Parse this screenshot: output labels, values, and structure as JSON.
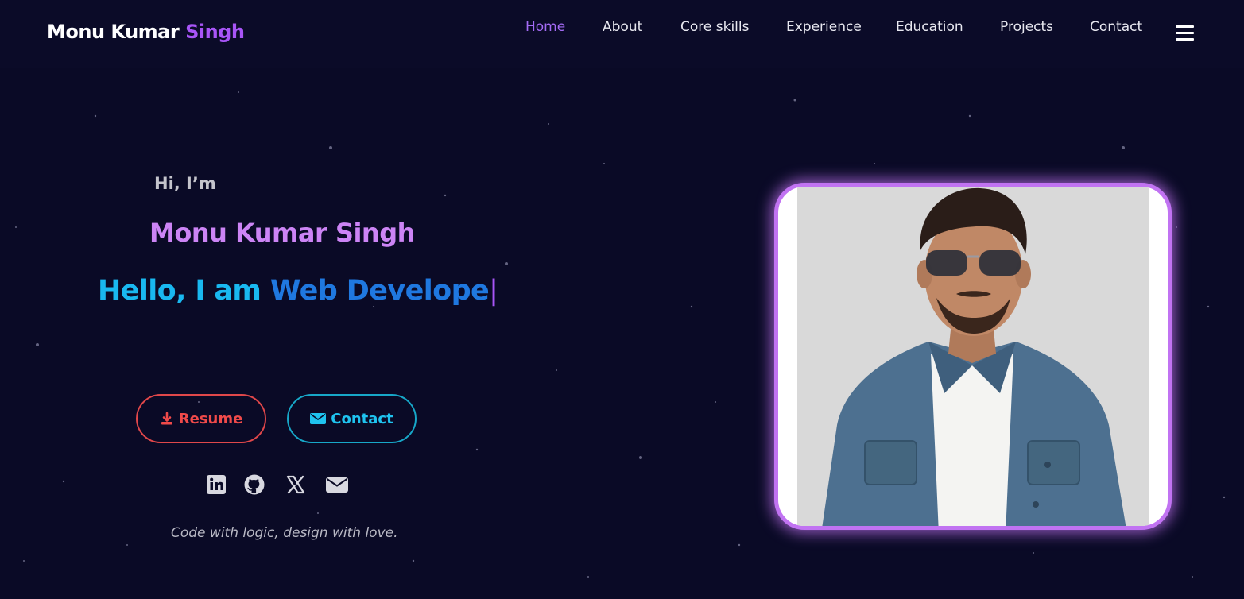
{
  "brand": {
    "first": "Monu Kumar",
    "accent": "Singh"
  },
  "nav": {
    "items": [
      {
        "label": "Home",
        "active": true
      },
      {
        "label": "About",
        "active": false
      },
      {
        "label": "Core skills",
        "active": false
      },
      {
        "label": "Experience",
        "active": false
      },
      {
        "label": "Education",
        "active": false
      },
      {
        "label": "Projects",
        "active": false
      },
      {
        "label": "Contact",
        "active": false
      }
    ],
    "menu_icon": "hamburger-icon"
  },
  "hero": {
    "greeting": "Hi, I’m",
    "name": "Monu Kumar Singh",
    "typing_prefix": "Hello, I am ",
    "typing_role": "Web Develope",
    "typing_cursor": "|",
    "buttons": {
      "resume": {
        "label": "Resume",
        "icon": "download-icon"
      },
      "contact": {
        "label": "Contact",
        "icon": "envelope-icon"
      }
    },
    "socials": [
      {
        "name": "linkedin-icon"
      },
      {
        "name": "github-icon"
      },
      {
        "name": "x-twitter-icon"
      },
      {
        "name": "email-icon"
      }
    ],
    "tagline": "Code with logic, design with love."
  },
  "colors": {
    "background": "#0a0a26",
    "accent_purple": "#a855f7",
    "name_gradient": "#cc84f5",
    "resume_red": "#f04a4a",
    "contact_cyan": "#1fc3ef",
    "typing_blue": "#1f78e0"
  }
}
